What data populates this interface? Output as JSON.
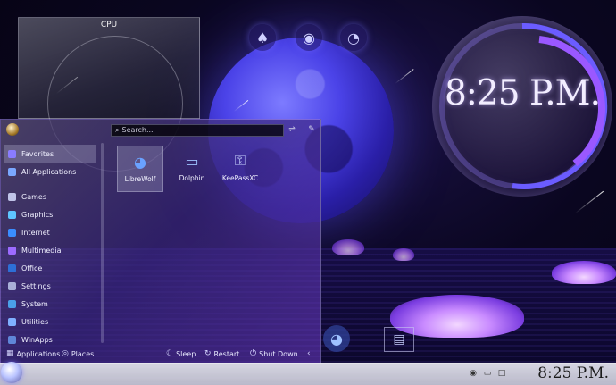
{
  "cpu_widget": {
    "title": "CPU"
  },
  "clock_widget": {
    "time": "8:25 P.M."
  },
  "desktop_icons": [
    {
      "name": "cards-icon",
      "glyph": "♠"
    },
    {
      "name": "media-reel-icon",
      "glyph": "◉"
    },
    {
      "name": "citrus-icon",
      "glyph": "◔"
    }
  ],
  "launcher": {
    "search_placeholder": "Search...",
    "sidebar": [
      {
        "label": "Favorites",
        "icon_color": "#8a7cff",
        "active": true
      },
      {
        "label": "All Applications",
        "icon_color": "#7aa8ff",
        "active": false
      },
      {
        "label": "Games",
        "icon_color": "#c0c4e8",
        "active": false
      },
      {
        "label": "Graphics",
        "icon_color": "#5ec6ff",
        "active": false
      },
      {
        "label": "Internet",
        "icon_color": "#3a8dff",
        "active": false
      },
      {
        "label": "Multimedia",
        "icon_color": "#9c6bff",
        "active": false
      },
      {
        "label": "Office",
        "icon_color": "#2d6fd6",
        "active": false
      },
      {
        "label": "Settings",
        "icon_color": "#a9b0d8",
        "active": false
      },
      {
        "label": "System",
        "icon_color": "#4aa0e8",
        "active": false
      },
      {
        "label": "Utilities",
        "icon_color": "#7fb0ff",
        "active": false
      },
      {
        "label": "WinApps",
        "icon_color": "#5f86d8",
        "active": false
      }
    ],
    "apps": [
      {
        "label": "LibreWolf",
        "glyph": "◕",
        "color": "#6aa2ff",
        "active": true
      },
      {
        "label": "Dolphin",
        "glyph": "▭",
        "color": "#9fc4ff",
        "active": false
      },
      {
        "label": "KeePassXC",
        "glyph": "⚿",
        "color": "#c9d3ff",
        "active": false
      }
    ],
    "footer": {
      "applications": "Applications",
      "places": "Places",
      "sleep": "Sleep",
      "restart": "Restart",
      "shutdown": "Shut Down"
    }
  },
  "taskbar": {
    "clock": "8:25 P.M."
  }
}
